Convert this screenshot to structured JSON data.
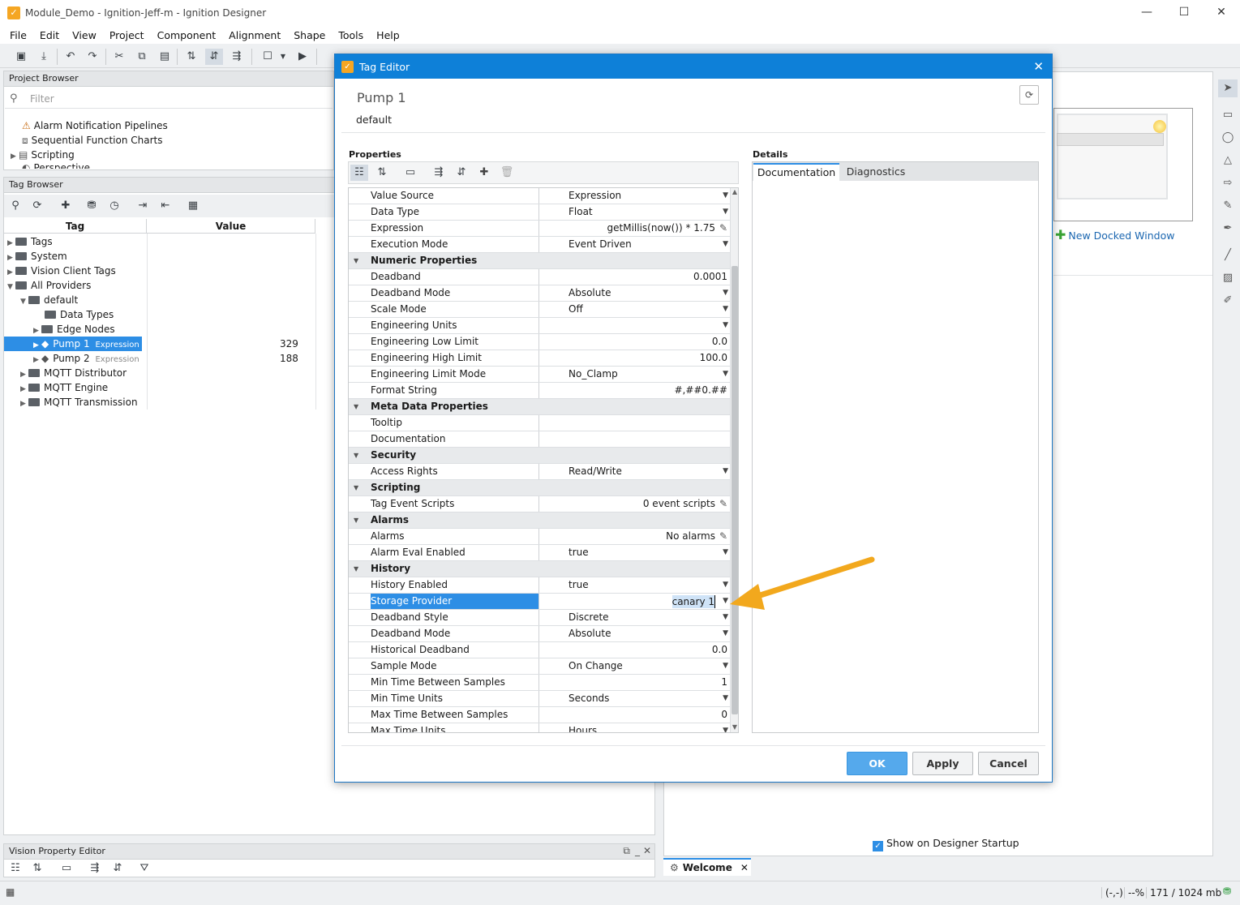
{
  "window": {
    "title": "Module_Demo - Ignition-Jeff-m - Ignition Designer",
    "minimize": "—",
    "maximize": "☐",
    "close": "✕"
  },
  "menu": [
    "File",
    "Edit",
    "View",
    "Project",
    "Component",
    "Alignment",
    "Shape",
    "Tools",
    "Help"
  ],
  "project_browser": {
    "title": "Project Browser",
    "filter_placeholder": "Filter",
    "items": [
      "Alarm Notification Pipelines",
      "Sequential Function Charts",
      "Scripting",
      "Perspective"
    ]
  },
  "tag_browser": {
    "title": "Tag Browser",
    "col_tag": "Tag",
    "col_value": "Value",
    "rows": [
      {
        "label": "Tags",
        "value": "",
        "badge": ""
      },
      {
        "label": "System",
        "value": "",
        "badge": ""
      },
      {
        "label": "Vision Client Tags",
        "value": "",
        "badge": ""
      },
      {
        "label": "All Providers",
        "value": "",
        "badge": ""
      },
      {
        "label": "default",
        "value": "",
        "badge": ""
      },
      {
        "label": "Data Types",
        "value": "",
        "badge": ""
      },
      {
        "label": "Edge Nodes",
        "value": "",
        "badge": ""
      },
      {
        "label": "Pump 1",
        "value": "329",
        "badge": "Expression"
      },
      {
        "label": "Pump 2",
        "value": "188",
        "badge": "Expression"
      },
      {
        "label": "MQTT Distributor",
        "value": "",
        "badge": ""
      },
      {
        "label": "MQTT Engine",
        "value": "",
        "badge": ""
      },
      {
        "label": "MQTT Transmission",
        "value": "",
        "badge": ""
      }
    ]
  },
  "vision_property_editor": {
    "title": "Vision Property Editor"
  },
  "tag_editor": {
    "title": "Tag Editor",
    "tag_name": "Pump 1",
    "provider": "default",
    "properties_label": "Properties",
    "details_label": "Details",
    "tabs": [
      "Documentation",
      "Diagnostics"
    ],
    "properties": [
      {
        "type": "prop",
        "name": "Value Source",
        "value": "Expression",
        "kind": "dropdown"
      },
      {
        "type": "prop",
        "name": "Data Type",
        "value": "Float",
        "kind": "dropdown"
      },
      {
        "type": "prop",
        "name": "Expression",
        "value": "getMillis(now()) * 1.75",
        "kind": "edit"
      },
      {
        "type": "prop",
        "name": "Execution Mode",
        "value": "Event Driven",
        "kind": "dropdown"
      },
      {
        "type": "cat",
        "name": "Numeric Properties"
      },
      {
        "type": "prop",
        "name": "Deadband",
        "value": "0.0001",
        "kind": "number"
      },
      {
        "type": "prop",
        "name": "Deadband Mode",
        "value": "Absolute",
        "kind": "dropdown"
      },
      {
        "type": "prop",
        "name": "Scale Mode",
        "value": "Off",
        "kind": "dropdown"
      },
      {
        "type": "prop",
        "name": "Engineering Units",
        "value": "",
        "kind": "dropdown"
      },
      {
        "type": "prop",
        "name": "Engineering Low Limit",
        "value": "0.0",
        "kind": "number"
      },
      {
        "type": "prop",
        "name": "Engineering High Limit",
        "value": "100.0",
        "kind": "number"
      },
      {
        "type": "prop",
        "name": "Engineering Limit Mode",
        "value": "No_Clamp",
        "kind": "dropdown"
      },
      {
        "type": "prop",
        "name": "Format String",
        "value": "#,##0.##",
        "kind": "number"
      },
      {
        "type": "cat",
        "name": "Meta Data Properties"
      },
      {
        "type": "prop",
        "name": "Tooltip",
        "value": "",
        "kind": "text"
      },
      {
        "type": "prop",
        "name": "Documentation",
        "value": "",
        "kind": "text"
      },
      {
        "type": "cat",
        "name": "Security"
      },
      {
        "type": "prop",
        "name": "Access Rights",
        "value": "Read/Write",
        "kind": "dropdown"
      },
      {
        "type": "cat",
        "name": "Scripting"
      },
      {
        "type": "prop",
        "name": "Tag Event Scripts",
        "value": "0 event scripts",
        "kind": "edit"
      },
      {
        "type": "cat",
        "name": "Alarms"
      },
      {
        "type": "prop",
        "name": "Alarms",
        "value": "No alarms",
        "kind": "edit"
      },
      {
        "type": "prop",
        "name": "Alarm Eval Enabled",
        "value": "true",
        "kind": "dropdown"
      },
      {
        "type": "cat",
        "name": "History"
      },
      {
        "type": "prop",
        "name": "History Enabled",
        "value": "true",
        "kind": "dropdown"
      },
      {
        "type": "prop",
        "name": "Storage Provider",
        "value": "canary 1",
        "kind": "dropdown-right",
        "selected": true
      },
      {
        "type": "prop",
        "name": "Deadband Style",
        "value": "Discrete",
        "kind": "dropdown"
      },
      {
        "type": "prop",
        "name": "Deadband Mode",
        "value": "Absolute",
        "kind": "dropdown"
      },
      {
        "type": "prop",
        "name": "Historical Deadband",
        "value": "0.0",
        "kind": "number"
      },
      {
        "type": "prop",
        "name": "Sample Mode",
        "value": "On Change",
        "kind": "dropdown"
      },
      {
        "type": "prop",
        "name": "Min Time Between Samples",
        "value": "1",
        "kind": "number"
      },
      {
        "type": "prop",
        "name": "Min Time Units",
        "value": "Seconds",
        "kind": "dropdown"
      },
      {
        "type": "prop",
        "name": "Max Time Between Samples",
        "value": "0",
        "kind": "number"
      },
      {
        "type": "prop",
        "name": "Max Time Units",
        "value": "Hours",
        "kind": "dropdown"
      }
    ],
    "buttons": {
      "ok": "OK",
      "apply": "Apply",
      "cancel": "Cancel"
    }
  },
  "workspace": {
    "new_docked_window": "New Docked Window",
    "show_on_startup": "Show on Designer Startup",
    "welcome_tab": "Welcome",
    "accent_color": "#f5a623"
  },
  "statusbar": {
    "coords": "(-,-)",
    "zoom": "--%",
    "memory": "171 / 1024 mb"
  }
}
